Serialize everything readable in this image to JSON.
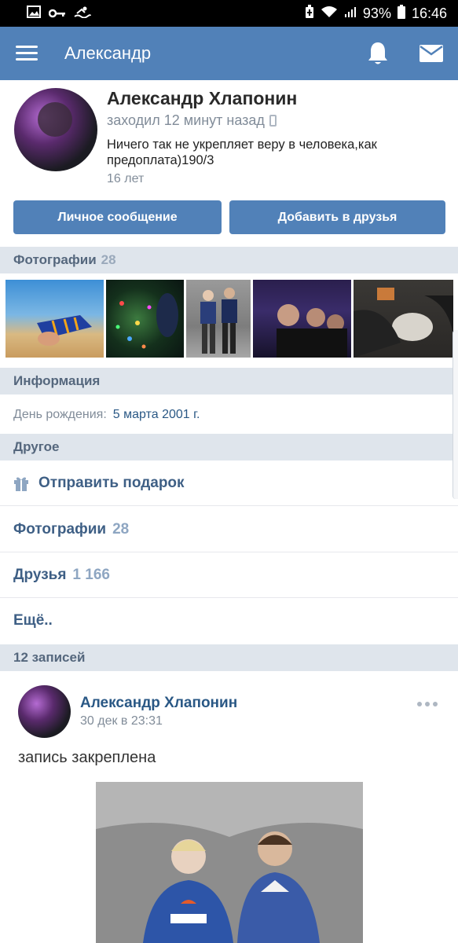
{
  "status_bar": {
    "battery": "93%",
    "time": "16:46"
  },
  "app_bar": {
    "title": "Александр"
  },
  "profile": {
    "name": "Александр Хлапонин",
    "last_seen": "заходил 12 минут назад",
    "status": "Ничего так не укрепляет веру в человека,как предоплата)190/3",
    "age": "16 лет",
    "message_button": "Личное сообщение",
    "add_friend_button": "Добавить в друзья"
  },
  "photos_section": {
    "label": "Фотографии",
    "count": "28"
  },
  "info_section": {
    "label": "Информация",
    "birthday_label": "День рождения:",
    "birthday_value": "5 марта 2001 г."
  },
  "other_section": {
    "label": "Другое",
    "send_gift": "Отправить подарок",
    "photos_label": "Фотографии",
    "photos_count": "28",
    "friends_label": "Друзья",
    "friends_count": "1 166",
    "more": "Ещё.."
  },
  "posts_section": {
    "label": "12 записей"
  },
  "post": {
    "author": "Александр Хлапонин",
    "date": "30 дек в 23:31",
    "text": "запись закреплена"
  },
  "colors": {
    "accent": "#5181b8",
    "section_bg": "#dfe5ec",
    "link": "#2a5885"
  }
}
